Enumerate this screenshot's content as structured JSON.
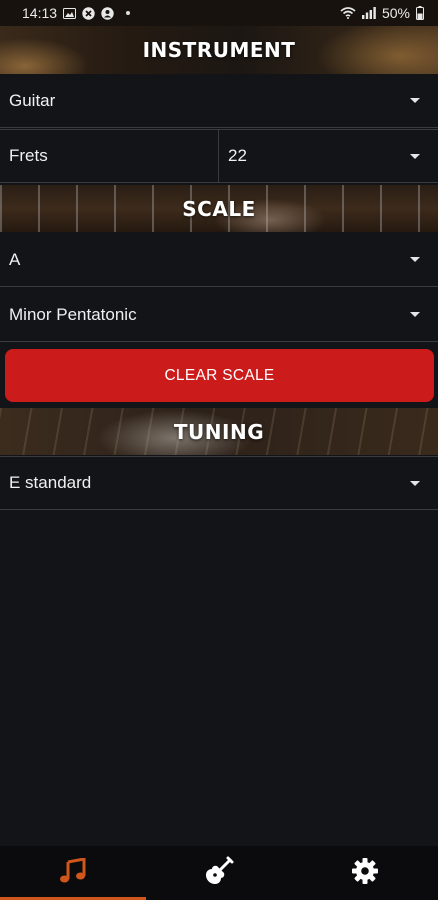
{
  "status_bar": {
    "time": "14:13",
    "battery": "50%",
    "icons": [
      "gallery-icon",
      "x-icon",
      "account-icon",
      "wifi-icon",
      "signal-icon",
      "battery-icon"
    ]
  },
  "sections": {
    "instrument": {
      "title": "INSTRUMENT"
    },
    "scale": {
      "title": "SCALE"
    },
    "tuning": {
      "title": "TUNING"
    }
  },
  "instrument": {
    "selected": "Guitar",
    "frets_label": "Frets",
    "frets_value": "22"
  },
  "scale": {
    "root": "A",
    "type": "Minor Pentatonic",
    "clear_label": "CLEAR SCALE"
  },
  "tuning": {
    "selected": "E standard"
  },
  "nav": {
    "items": [
      {
        "icon": "music-note-icon",
        "active": true
      },
      {
        "icon": "guitar-icon",
        "active": false
      },
      {
        "icon": "gear-icon",
        "active": false
      }
    ],
    "active_color": "#d0571c"
  },
  "colors": {
    "background": "#131418",
    "clear_button": "#cc1b1b",
    "accent": "#d0571c"
  }
}
